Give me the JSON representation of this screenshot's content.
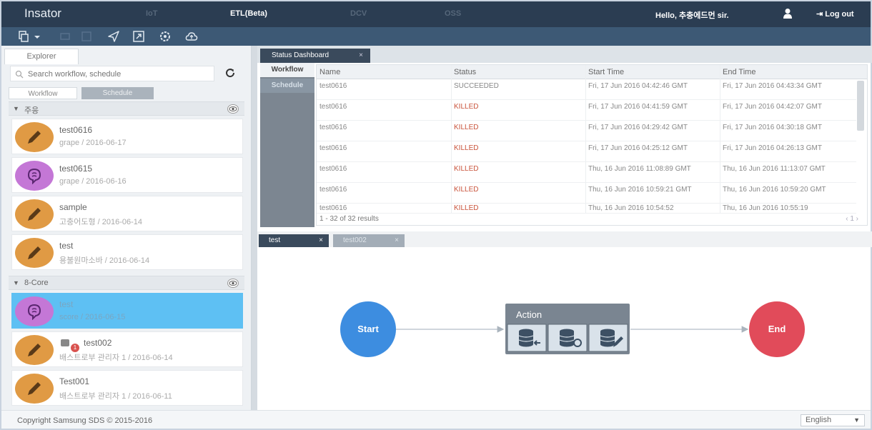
{
  "header": {
    "brand": "Insator",
    "nav": [
      "IoT",
      "ETL(Beta)",
      "DCV",
      "OSS"
    ],
    "active_nav": "ETL(Beta)",
    "greeting": "Hello, 추충에드먼 sir.",
    "logout": "Log out"
  },
  "toolbar": {
    "icons": [
      "copy-icon",
      "send-icon",
      "export-icon",
      "settings-icon",
      "cloud-upload-icon"
    ]
  },
  "explorer": {
    "tab": "Explorer",
    "search_placeholder": "Search workflow, schedule",
    "tabs": {
      "workflow": "Workflow",
      "schedule": "Schedule"
    },
    "groups": [
      {
        "name": "주응",
        "items": [
          {
            "title": "test0616",
            "subtitle": "grape / 2016-06-17",
            "icon": "pencil-icon",
            "color": "#e09a44"
          },
          {
            "title": "test0615",
            "subtitle": "grape / 2016-06-16",
            "icon": "brain-icon",
            "color": "#c477d6"
          },
          {
            "title": "sample",
            "subtitle": "고충어도형 / 2016-06-14",
            "icon": "pencil-icon",
            "color": "#e09a44"
          },
          {
            "title": "test",
            "subtitle": "용불원마소바 / 2016-06-14",
            "icon": "pencil-icon",
            "color": "#e09a44"
          }
        ]
      },
      {
        "name": "8-Core",
        "items": [
          {
            "title": "test",
            "subtitle": "score / 2016-06-15",
            "icon": "brain-icon",
            "color": "#c477d6",
            "selected": true
          },
          {
            "title": "test002",
            "subtitle": "배스트로부 관리자 1 / 2016-06-14",
            "icon": "pencil-icon",
            "color": "#e09a44",
            "badge": "1"
          },
          {
            "title": "Test001",
            "subtitle": "배스트로부 관리자 1 / 2016-06-11",
            "icon": "pencil-icon",
            "color": "#e09a44"
          }
        ]
      }
    ]
  },
  "dashboard": {
    "tab": "Status Dashboard",
    "side": [
      "Workflow",
      "Schedule"
    ],
    "columns": [
      "Name",
      "Status",
      "Start Time",
      "End Time"
    ],
    "rows": [
      [
        "test0616",
        "SUCCEEDED",
        "Fri, 17 Jun 2016 04:42:46 GMT",
        "Fri, 17 Jun 2016 04:43:34 GMT"
      ],
      [
        "test0616",
        "KILLED",
        "Fri, 17 Jun 2016 04:41:59 GMT",
        "Fri, 17 Jun 2016 04:42:07 GMT"
      ],
      [
        "test0616",
        "KILLED",
        "Fri, 17 Jun 2016 04:29:42 GMT",
        "Fri, 17 Jun 2016 04:30:18 GMT"
      ],
      [
        "test0616",
        "KILLED",
        "Fri, 17 Jun 2016 04:25:12 GMT",
        "Fri, 17 Jun 2016 04:26:13 GMT"
      ],
      [
        "test0616",
        "KILLED",
        "Thu, 16 Jun 2016 11:08:89 GMT",
        "Thu, 16 Jun 2016 11:13:07 GMT"
      ],
      [
        "test0616",
        "KILLED",
        "Thu, 16 Jun 2016 10:59:21 GMT",
        "Thu, 16 Jun 2016 10:59:20 GMT"
      ],
      [
        "test0616",
        "KILLED",
        "Thu, 16 Jun 2016 10:54:52",
        "Thu, 16 Jun 2016 10:55:19"
      ]
    ],
    "result_count": "1 - 32 of 32 results",
    "pager": "‹ 1 ›"
  },
  "editor": {
    "tabs": [
      "test",
      "test002"
    ],
    "flow": {
      "start": "Start",
      "action": "Action",
      "end": "End"
    },
    "colors": {
      "start": "#3d8de0",
      "end": "#e14b5a",
      "action": "#7a8591"
    }
  },
  "footer": {
    "copyright": "Copyright Samsung SDS © 2015-2016",
    "language": "English"
  }
}
